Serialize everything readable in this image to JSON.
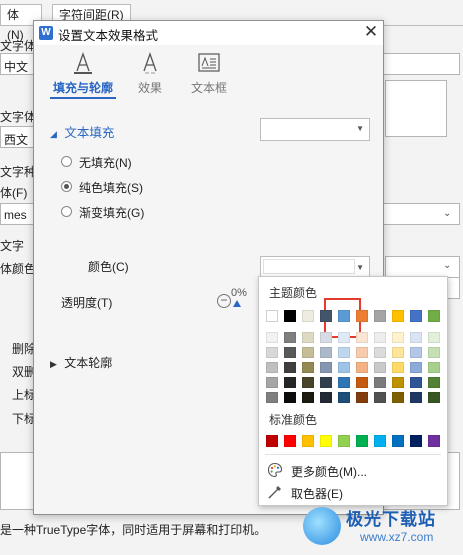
{
  "background": {
    "tab_left": "体(N)",
    "tab_right": "字符间距(R)",
    "labels": [
      "文字体",
      "中文",
      "文字体",
      "西文",
      "文字种",
      "体(F)",
      "mes",
      "文字",
      "体颜色",
      "删除",
      "双删",
      "上标",
      "下标"
    ],
    "footer": "是一种TrueType字体，同时适用于屏幕和打印机。"
  },
  "dialog": {
    "title": "设置文本效果格式",
    "tabs": [
      {
        "label": "填充与轮廓",
        "icon": "text-outline-icon",
        "active": true
      },
      {
        "label": "效果",
        "icon": "text-effect-icon",
        "active": false
      },
      {
        "label": "文本框",
        "icon": "textbox-icon",
        "active": false
      }
    ],
    "fill_section": "文本填充",
    "radios": [
      {
        "label": "无填充(N)",
        "checked": false
      },
      {
        "label": "纯色填充(S)",
        "checked": true
      },
      {
        "label": "渐变填充(G)",
        "checked": false
      }
    ],
    "color_label": "颜色(C)",
    "transparency_label": "透明度(T)",
    "transparency_value": "0%",
    "outline_section": "文本轮廓"
  },
  "color_popup": {
    "theme_heading": "主题颜色",
    "standard_heading": "标准颜色",
    "more_colors": "更多颜色(M)...",
    "eyedropper": "取色器(E)",
    "theme_top": [
      "#ffffff",
      "#000000",
      "#eeece1",
      "#44546a",
      "#5b9bd5",
      "#ed7d31",
      "#a5a5a5",
      "#ffc000",
      "#4472c4",
      "#70ad47"
    ],
    "theme_shades": [
      [
        "#f2f2f2",
        "#7f7f7f",
        "#ddd9c3",
        "#d6dce4",
        "#deebf6",
        "#fbe5d5",
        "#ededed",
        "#fff2cc",
        "#dae3f3",
        "#e2efd9"
      ],
      [
        "#d8d8d8",
        "#595959",
        "#c4bd97",
        "#adb9ca",
        "#bdd7ee",
        "#f7cbac",
        "#dbdbdb",
        "#fee599",
        "#b4c6e7",
        "#c5e0b3"
      ],
      [
        "#bfbfbf",
        "#3f3f3f",
        "#938953",
        "#8496b0",
        "#9dc3e6",
        "#f4b183",
        "#c9c9c9",
        "#ffd965",
        "#8eaadb",
        "#a8d08d"
      ],
      [
        "#a5a5a5",
        "#262626",
        "#494429",
        "#323f4f",
        "#2e75b5",
        "#c55a11",
        "#7b7b7b",
        "#bf9000",
        "#2f5496",
        "#538135"
      ],
      [
        "#7f7f7f",
        "#0c0c0c",
        "#1d1b10",
        "#222a35",
        "#1e4e79",
        "#833c0b",
        "#525252",
        "#7f6000",
        "#1f3864",
        "#375623"
      ]
    ],
    "standard": [
      "#c00000",
      "#ff0000",
      "#ffc000",
      "#ffff00",
      "#92d050",
      "#00b050",
      "#00b0f0",
      "#0070c0",
      "#002060",
      "#7030a0"
    ]
  },
  "watermark": {
    "title": "极光下载站",
    "url": "www.xz7.com"
  }
}
